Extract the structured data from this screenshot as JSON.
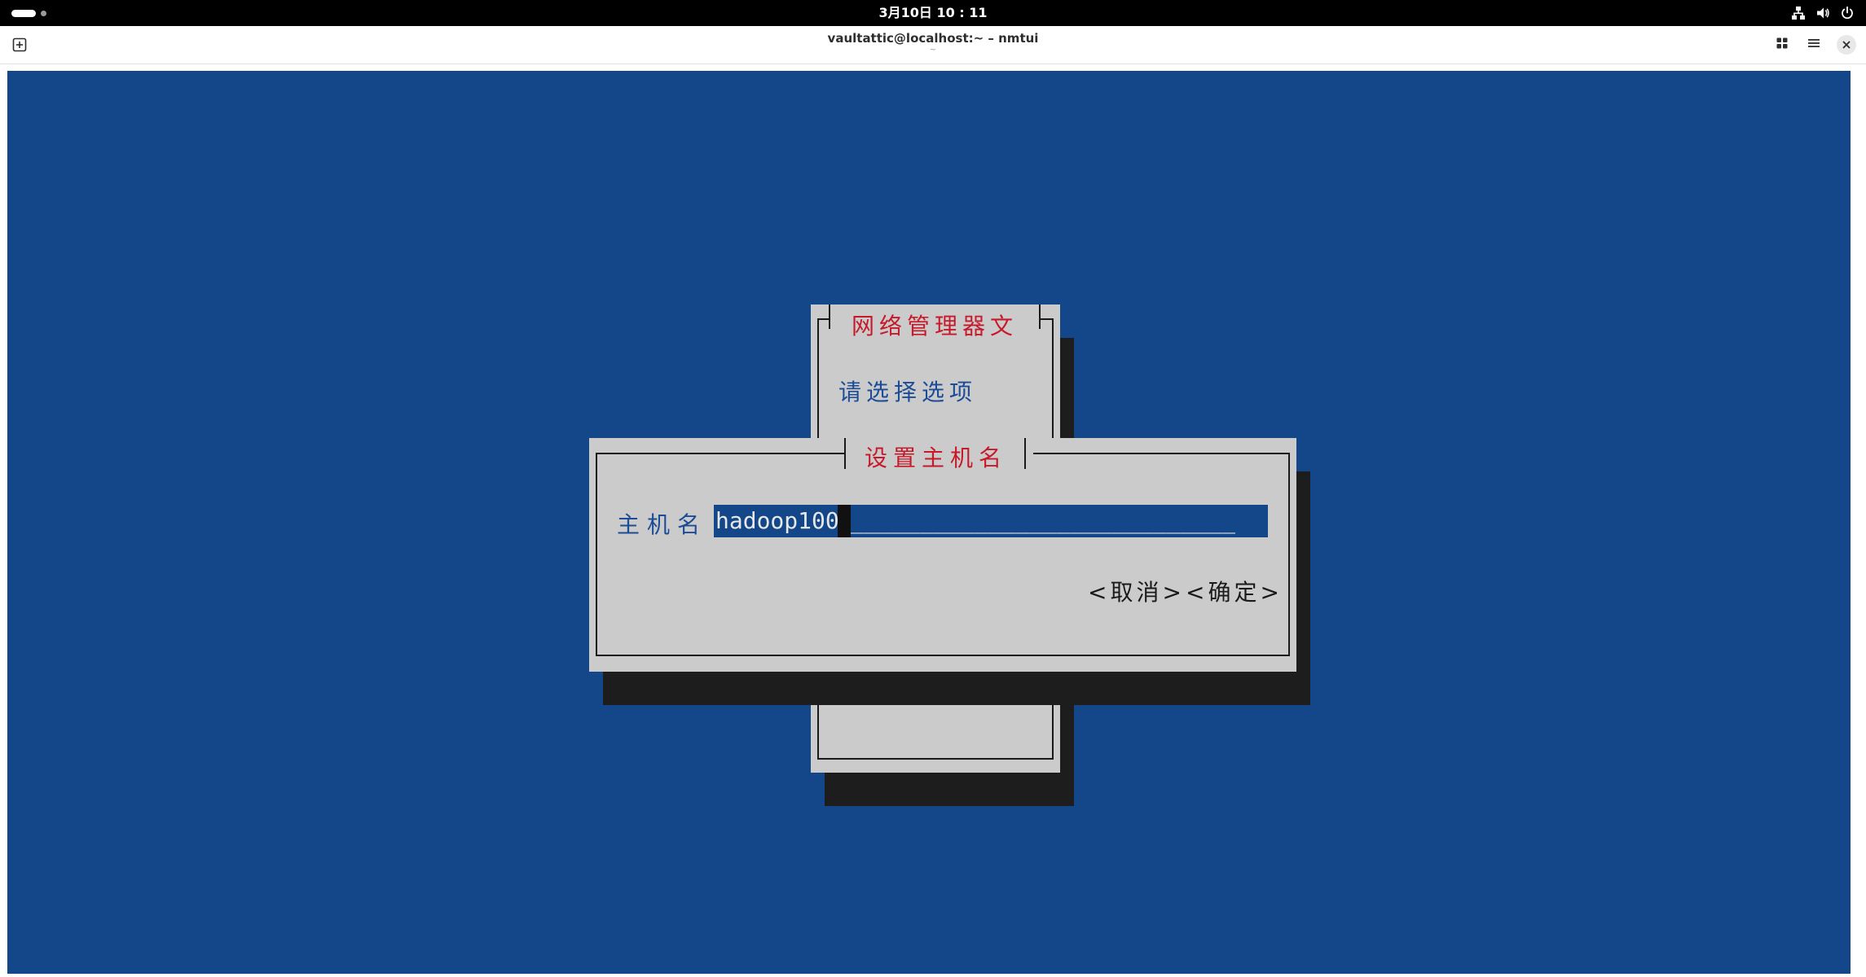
{
  "topbar": {
    "clock": "3月10日 10 : 11",
    "icons": [
      "network-wired-icon",
      "volume-icon",
      "power-icon"
    ]
  },
  "window": {
    "title": "vaultattic@localhost:~ – nmtui",
    "subtitle": "~",
    "buttons": [
      "new-tab-icon",
      "view-grid-icon",
      "hamburger-menu-icon",
      "close-icon"
    ]
  },
  "background_dialog": {
    "title": "网络管理器文",
    "prompt": "请选择选项"
  },
  "hostname_dialog": {
    "title": "设置主机名",
    "field_label": "主机名",
    "hostname_value": "hadoop100",
    "field_fill": "____________________________",
    "cancel_label": "<取消>",
    "ok_label": "<确定>"
  },
  "colors": {
    "terminal_bg": "#13478a",
    "panel_bg": "#cbcbcb",
    "title_red": "#c6192a",
    "label_blue": "#1c4c95",
    "shadow": "#1d1d1d"
  }
}
